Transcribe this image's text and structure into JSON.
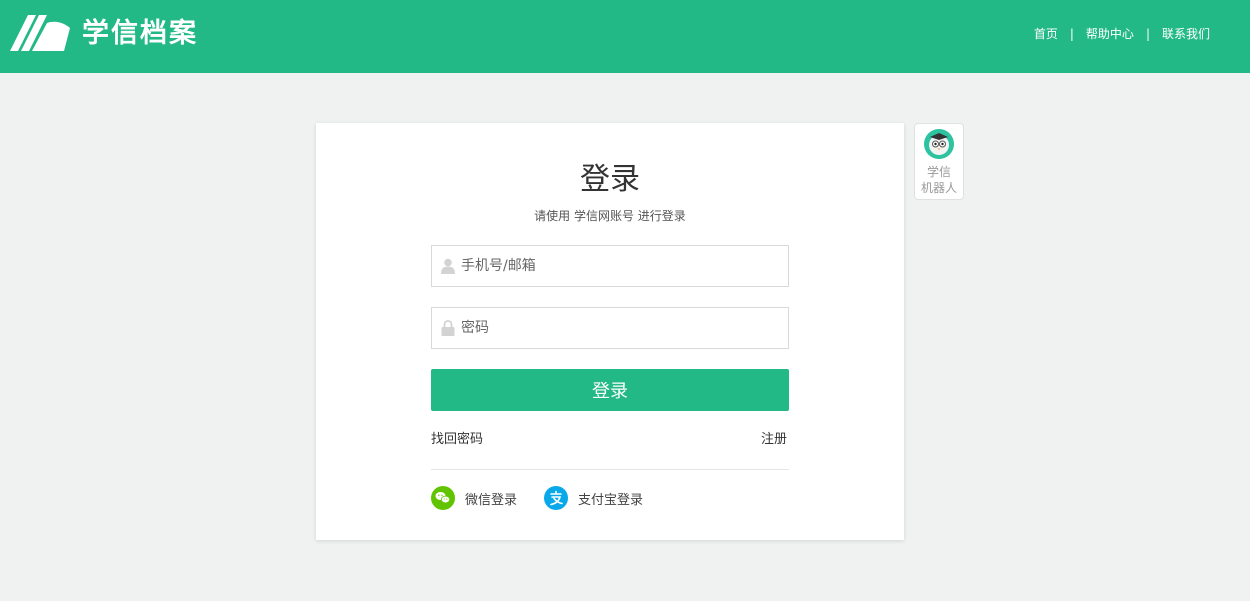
{
  "header": {
    "logo_text": "学信档案",
    "nav": {
      "home": "首页",
      "help": "帮助中心",
      "contact": "联系我们",
      "separator": "|"
    }
  },
  "login": {
    "title": "登录",
    "subtitle": "请使用 学信网账号 进行登录",
    "username_placeholder": "手机号/邮箱",
    "password_placeholder": "密码",
    "submit_label": "登录",
    "forgot_password": "找回密码",
    "register": "注册",
    "wechat_login": "微信登录",
    "alipay_login": "支付宝登录"
  },
  "robot": {
    "line1": "学信",
    "line2": "机器人"
  },
  "colors": {
    "brand": "#23b987",
    "background": "#eff2f1",
    "wechat": "#62c400",
    "alipay": "#09a9e9"
  }
}
